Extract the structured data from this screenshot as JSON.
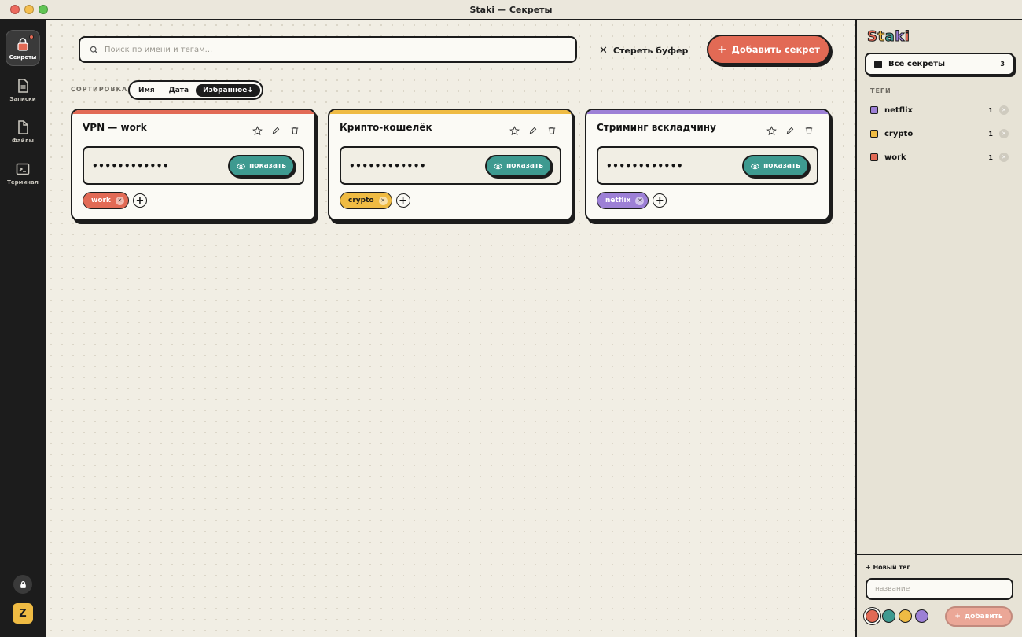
{
  "window": {
    "title": "Staki — Секреты"
  },
  "nav": {
    "items": [
      {
        "label": "Секреты",
        "icon": "lock-icon",
        "active": true
      },
      {
        "label": "Записки",
        "icon": "note-icon"
      },
      {
        "label": "Файлы",
        "icon": "file-icon"
      },
      {
        "label": "Терминал",
        "icon": "terminal-icon"
      }
    ],
    "user_initial": "Z"
  },
  "toolbar": {
    "search_placeholder": "Поиск по имени и тегам...",
    "clear_label": "Стереть буфер",
    "add_label": "Добавить секрет"
  },
  "sort": {
    "label": "СОРТИРОВКА",
    "options": [
      "Имя",
      "Дата",
      "Избранное↓"
    ],
    "active": "Избранное↓"
  },
  "cards": [
    {
      "title": "VPN — work",
      "password": "••••••••••••",
      "show_label": "показать",
      "color": "#e26a55",
      "tags": [
        {
          "name": "work",
          "color": "#e26a55"
        }
      ]
    },
    {
      "title": "Крипто-кошелёк",
      "password": "••••••••••••",
      "show_label": "показать",
      "color": "#efbb43",
      "tags": [
        {
          "name": "crypto",
          "color": "#efbb43"
        }
      ]
    },
    {
      "title": "Стриминг вскладчину",
      "password": "••••••••••••",
      "show_label": "показать",
      "color": "#9d80d6",
      "tags": [
        {
          "name": "netflix",
          "color": "#9d80d6"
        }
      ]
    }
  ],
  "sidebar": {
    "logo": "Staki",
    "all_label": "Все секреты",
    "all_count": "3",
    "tags_header": "ТЕГИ",
    "tags": [
      {
        "name": "netflix",
        "count": "1",
        "color": "#9d80d6"
      },
      {
        "name": "crypto",
        "count": "1",
        "color": "#efbb43"
      },
      {
        "name": "work",
        "count": "1",
        "color": "#e26a55"
      }
    ],
    "new_tag": {
      "header": "+ Новый тег",
      "placeholder": "название",
      "colors": [
        "#e26a55",
        "#3e9a90",
        "#efbb43",
        "#9d80d6"
      ],
      "add_label": "добавить"
    }
  }
}
